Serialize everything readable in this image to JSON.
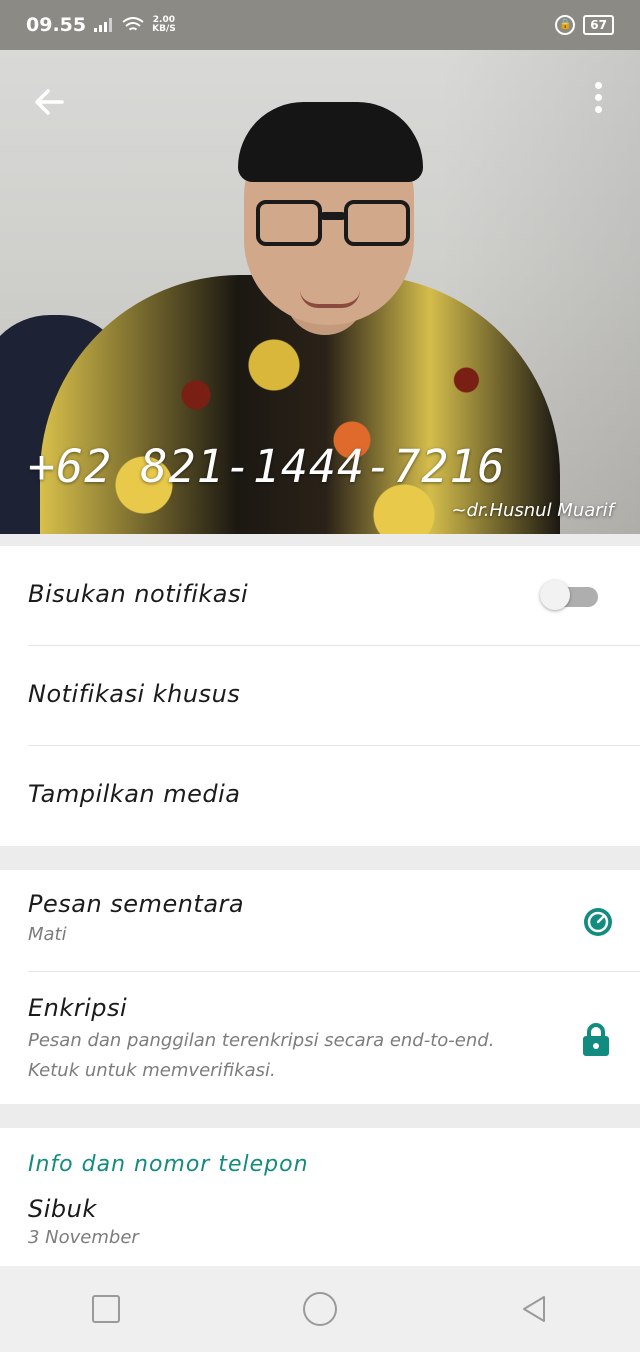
{
  "status_bar": {
    "time": "09.55",
    "speed_value": "2.00",
    "speed_unit": "KB/S",
    "battery": "67",
    "icons": [
      "signal-icon",
      "wifi-icon",
      "lock-rotation-icon",
      "battery-icon"
    ]
  },
  "header": {
    "phone_watermark": "+62 821-1444-7216",
    "name_watermark": "~dr.Husnul Muarif",
    "icons": [
      "back-arrow-icon",
      "more-vert-icon"
    ]
  },
  "settings_1": {
    "mute_label": "Bisukan notifikasi",
    "mute_enabled": false,
    "custom_notif_label": "Notifikasi khusus",
    "media_label": "Tampilkan media"
  },
  "settings_2": {
    "disappearing_title": "Pesan sementara",
    "disappearing_value": "Mati",
    "encryption_title": "Enkripsi",
    "encryption_desc_1": "Pesan dan panggilan terenkripsi secara end-to-end.",
    "encryption_desc_2": "Ketuk untuk memverifikasi."
  },
  "info": {
    "section_title": "Info dan nomor telepon",
    "about": "Sibuk",
    "about_date": "3 November"
  },
  "colors": {
    "accent": "#128c7e",
    "status_bar": "#8c8a84",
    "divider": "#e6e6e6",
    "background": "#ececec"
  }
}
